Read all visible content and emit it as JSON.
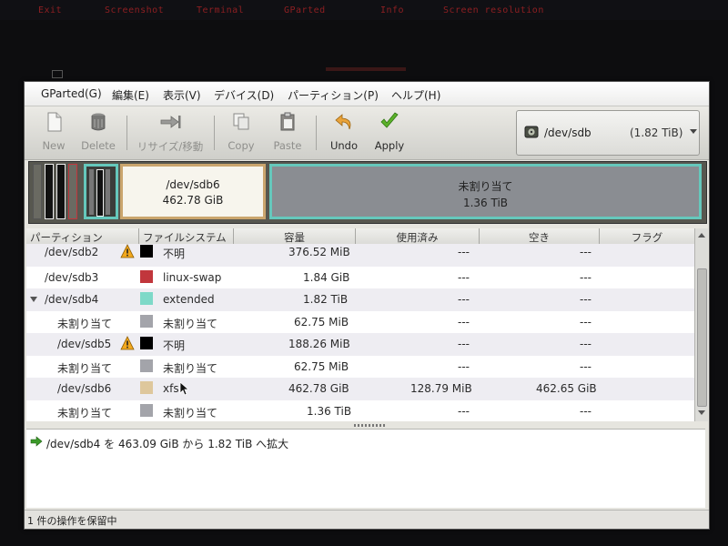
{
  "desktop_bar": {
    "items": [
      "Exit",
      "Screenshot",
      "Terminal",
      "GParted",
      "Info",
      "Screen resolution"
    ]
  },
  "menubar": {
    "items": [
      "GParted(G)",
      "編集(E)",
      "表示(V)",
      "デバイス(D)",
      "パーティション(P)",
      "ヘルプ(H)"
    ]
  },
  "toolbar": {
    "new": "New",
    "delete": "Delete",
    "resize": "リサイズ/移動",
    "copy": "Copy",
    "paste": "Paste",
    "undo": "Undo",
    "apply": "Apply"
  },
  "device": {
    "name": "/dev/sdb",
    "size": "(1.82 TiB)"
  },
  "disk_map": {
    "selected_name": "/dev/sdb6",
    "selected_size": "462.78 GiB",
    "free_name": "未割り当て",
    "free_size": "1.36 TiB"
  },
  "table": {
    "headers": [
      "パーティション",
      "ファイルシステム",
      "容量",
      "使用済み",
      "空き",
      "フラグ"
    ],
    "rows": [
      {
        "partition": "/dev/sdb2",
        "warning": true,
        "fs": "不明",
        "fs_color": "#000000",
        "size": "376.52 MiB",
        "used": "---",
        "free": "---"
      },
      {
        "partition": "/dev/sdb3",
        "warning": false,
        "fs": "linux-swap",
        "fs_color": "#c1363c",
        "size": "1.84 GiB",
        "used": "---",
        "free": "---"
      },
      {
        "partition": "/dev/sdb4",
        "warning": false,
        "fs": "extended",
        "fs_color": "#7ed9c8",
        "size": "1.82 TiB",
        "used": "---",
        "free": "---"
      },
      {
        "partition": "未割り当て",
        "warning": false,
        "fs": "未割り当て",
        "fs_color": "#a3a4aa",
        "size": "62.75 MiB",
        "used": "---",
        "free": "---"
      },
      {
        "partition": "/dev/sdb5",
        "warning": true,
        "fs": "不明",
        "fs_color": "#000000",
        "size": "188.26 MiB",
        "used": "---",
        "free": "---"
      },
      {
        "partition": "未割り当て",
        "warning": false,
        "fs": "未割り当て",
        "fs_color": "#a3a4aa",
        "size": "62.75 MiB",
        "used": "---",
        "free": "---"
      },
      {
        "partition": "/dev/sdb6",
        "warning": false,
        "fs": "xfs",
        "fs_color": "#dec79c",
        "size": "462.78 GiB",
        "used": "128.79 MiB",
        "free": "462.65 GiB"
      },
      {
        "partition": "未割り当て",
        "warning": false,
        "fs": "未割り当て",
        "fs_color": "#a3a4aa",
        "size": "1.36 TiB",
        "used": "---",
        "free": "---"
      }
    ]
  },
  "pending": {
    "operation": "/dev/sdb4 を 463.09 GiB から 1.82 TiB へ拡大"
  },
  "status": {
    "text": "1 件の操作を保留中"
  }
}
